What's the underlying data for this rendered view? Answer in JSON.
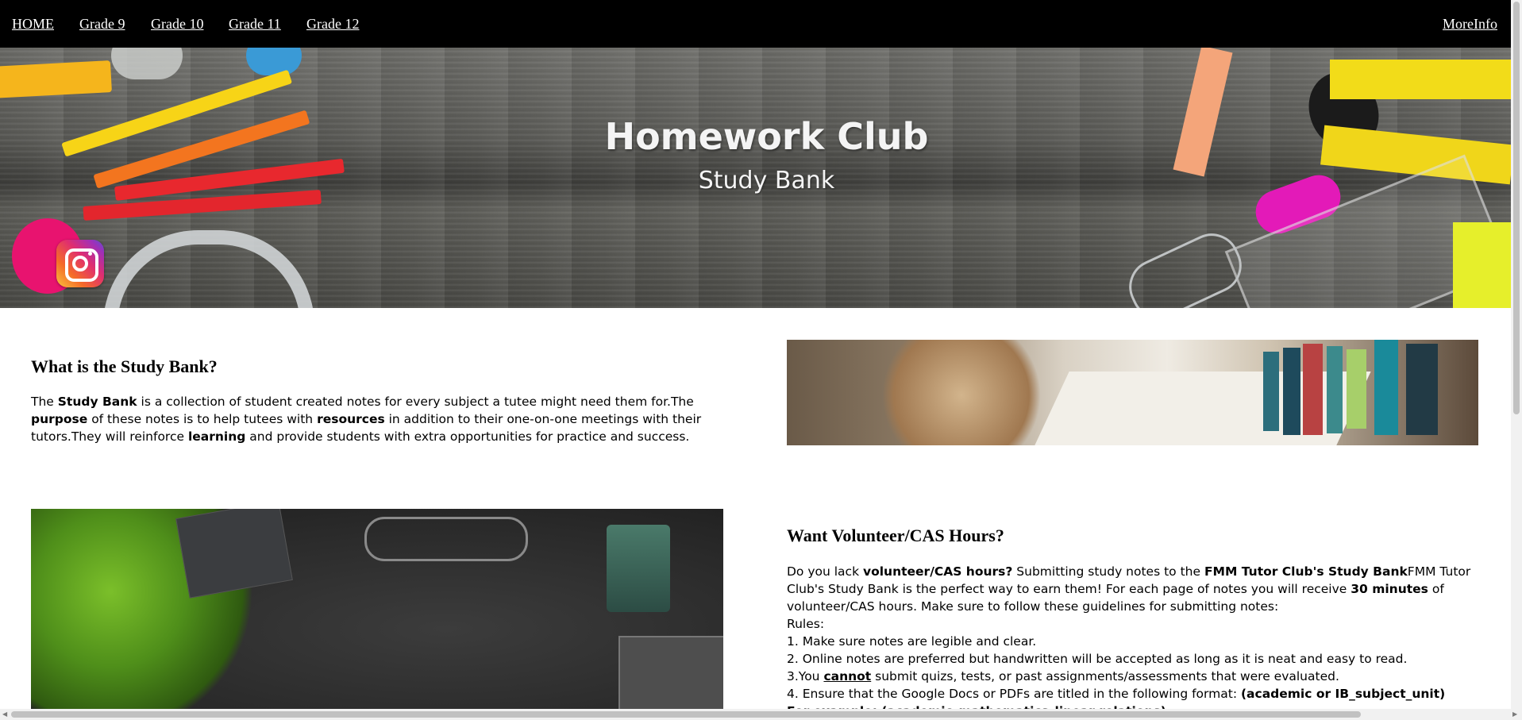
{
  "nav": {
    "home": "HOME",
    "grade9": "Grade 9",
    "grade10": "Grade 10",
    "grade11": "Grade 11",
    "grade12": "Grade 12",
    "more": "MoreInfo"
  },
  "hero": {
    "title": "Homework Club",
    "subtitle": "Study Bank",
    "social_icon": "instagram-icon"
  },
  "section1": {
    "heading": "What is the Study Bank?",
    "p1": "The ",
    "b1": "Study Bank",
    "p2": " is a collection of student created notes for every subject a tutee might need them for.The ",
    "b2": "purpose",
    "p3": " of these notes is to help tutees with ",
    "b3": "resources",
    "p4": " in addition to their one-on-one meetings with their tutors.They will reinforce ",
    "b4": "learning",
    "p5": " and provide students with extra opportunities for practice and success."
  },
  "section2": {
    "heading": "Want Volunteer/CAS Hours?",
    "t1": "Do you lack ",
    "b1": "volunteer/CAS hours?",
    "t2": " Submitting study notes to the ",
    "b2": "FMM Tutor Club's Study Bank",
    "t3": "FMM Tutor Club's Study Bank is the perfect way to earn them! For each page of notes you will receive ",
    "b3": "30 minutes",
    "t4": " of volunteer/CAS hours. Make sure to follow these guidelines for submitting notes:",
    "rules_label": "Rules:",
    "rule1": "1. Make sure notes are legible and clear.",
    "rule2": "2. Online notes are preferred but handwritten will be accepted as long as it is neat and easy to read.",
    "rule3_a": "3.You ",
    "rule3_b": "cannot",
    "rule3_c": " submit quizs, tests, or past assignments/assessments that were evaluated.",
    "rule4_a": "4. Ensure that the Google Docs or PDFs are titled in the following format: ",
    "rule4_b": "(academic or IB_subject_unit)",
    "rule5": "For example: (academic_mathematics_linear relations)"
  },
  "colors": {
    "nav_bg": "#000000",
    "hero_text": "#f4f4f4"
  }
}
